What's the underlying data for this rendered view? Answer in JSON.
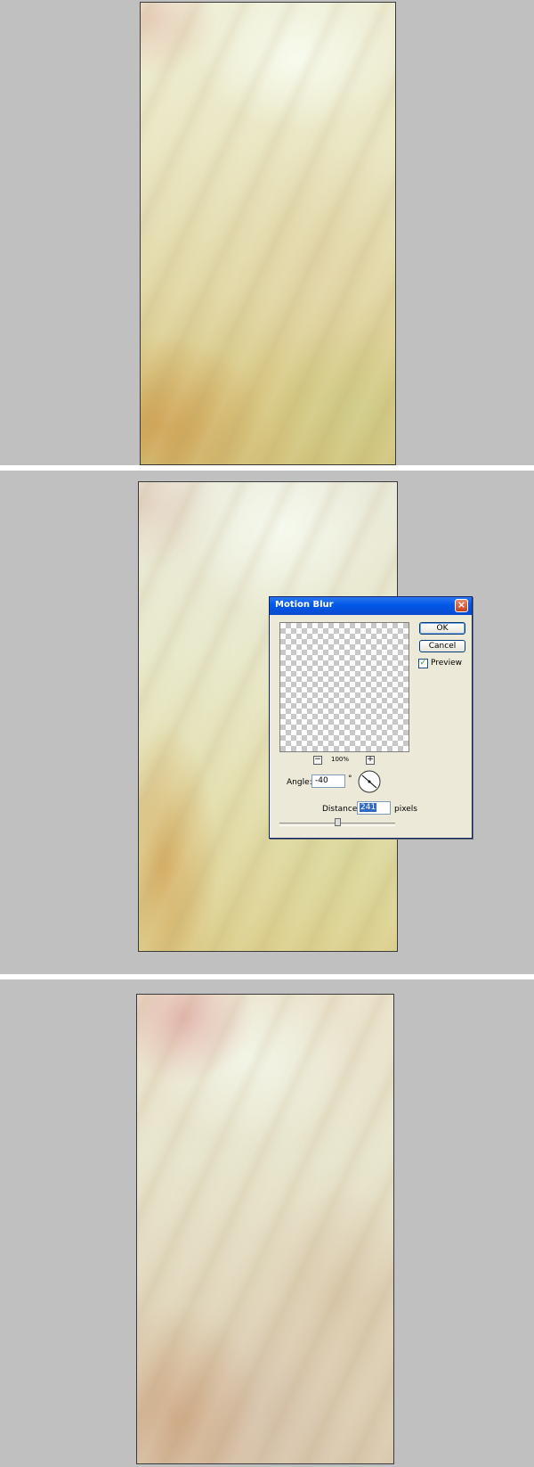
{
  "dialog": {
    "title": "Motion Blur",
    "ok_label": "OK",
    "cancel_label": "Cancel",
    "preview_label": "Preview",
    "preview_checked": true,
    "zoom_level": "100%",
    "zoom_out_symbol": "−",
    "zoom_in_symbol": "+",
    "angle_label": "Angle:",
    "angle_value": "-40",
    "angle_unit": "°",
    "distance_label": "Distance:",
    "distance_value": "241",
    "distance_unit": "pixels",
    "close_symbol": "×"
  },
  "icons": {
    "close": "close-icon",
    "zoom_in": "zoom-in-icon",
    "zoom_out": "zoom-out-icon",
    "angle_dial": "angle-dial-icon",
    "checkmark": "checkmark-icon"
  },
  "colors": {
    "background": "#c0c0c0",
    "titlebar": "#0058e6",
    "dialog_face": "#ece9d8",
    "selection": "#316ac5"
  }
}
